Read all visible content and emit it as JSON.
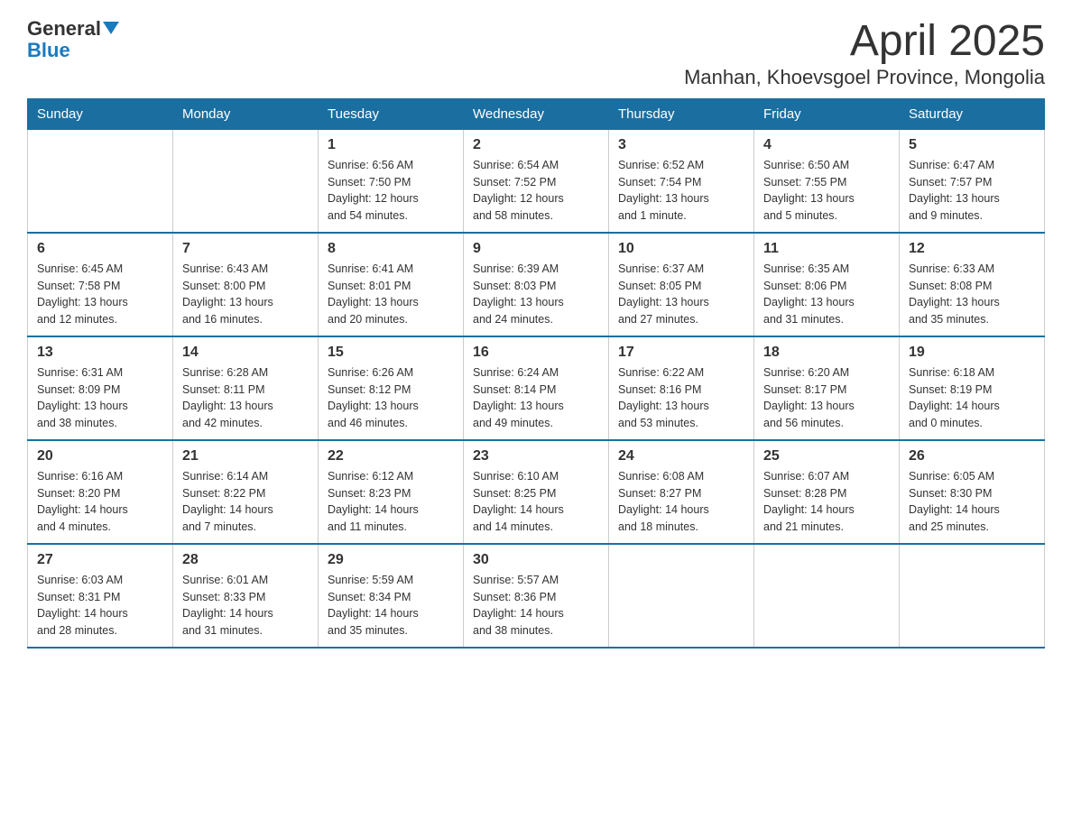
{
  "logo": {
    "text_general": "General",
    "text_blue": "Blue"
  },
  "title": "April 2025",
  "subtitle": "Manhan, Khoevsgoel Province, Mongolia",
  "weekdays": [
    "Sunday",
    "Monday",
    "Tuesday",
    "Wednesday",
    "Thursday",
    "Friday",
    "Saturday"
  ],
  "weeks": [
    [
      {
        "day": "",
        "info": ""
      },
      {
        "day": "",
        "info": ""
      },
      {
        "day": "1",
        "info": "Sunrise: 6:56 AM\nSunset: 7:50 PM\nDaylight: 12 hours\nand 54 minutes."
      },
      {
        "day": "2",
        "info": "Sunrise: 6:54 AM\nSunset: 7:52 PM\nDaylight: 12 hours\nand 58 minutes."
      },
      {
        "day": "3",
        "info": "Sunrise: 6:52 AM\nSunset: 7:54 PM\nDaylight: 13 hours\nand 1 minute."
      },
      {
        "day": "4",
        "info": "Sunrise: 6:50 AM\nSunset: 7:55 PM\nDaylight: 13 hours\nand 5 minutes."
      },
      {
        "day": "5",
        "info": "Sunrise: 6:47 AM\nSunset: 7:57 PM\nDaylight: 13 hours\nand 9 minutes."
      }
    ],
    [
      {
        "day": "6",
        "info": "Sunrise: 6:45 AM\nSunset: 7:58 PM\nDaylight: 13 hours\nand 12 minutes."
      },
      {
        "day": "7",
        "info": "Sunrise: 6:43 AM\nSunset: 8:00 PM\nDaylight: 13 hours\nand 16 minutes."
      },
      {
        "day": "8",
        "info": "Sunrise: 6:41 AM\nSunset: 8:01 PM\nDaylight: 13 hours\nand 20 minutes."
      },
      {
        "day": "9",
        "info": "Sunrise: 6:39 AM\nSunset: 8:03 PM\nDaylight: 13 hours\nand 24 minutes."
      },
      {
        "day": "10",
        "info": "Sunrise: 6:37 AM\nSunset: 8:05 PM\nDaylight: 13 hours\nand 27 minutes."
      },
      {
        "day": "11",
        "info": "Sunrise: 6:35 AM\nSunset: 8:06 PM\nDaylight: 13 hours\nand 31 minutes."
      },
      {
        "day": "12",
        "info": "Sunrise: 6:33 AM\nSunset: 8:08 PM\nDaylight: 13 hours\nand 35 minutes."
      }
    ],
    [
      {
        "day": "13",
        "info": "Sunrise: 6:31 AM\nSunset: 8:09 PM\nDaylight: 13 hours\nand 38 minutes."
      },
      {
        "day": "14",
        "info": "Sunrise: 6:28 AM\nSunset: 8:11 PM\nDaylight: 13 hours\nand 42 minutes."
      },
      {
        "day": "15",
        "info": "Sunrise: 6:26 AM\nSunset: 8:12 PM\nDaylight: 13 hours\nand 46 minutes."
      },
      {
        "day": "16",
        "info": "Sunrise: 6:24 AM\nSunset: 8:14 PM\nDaylight: 13 hours\nand 49 minutes."
      },
      {
        "day": "17",
        "info": "Sunrise: 6:22 AM\nSunset: 8:16 PM\nDaylight: 13 hours\nand 53 minutes."
      },
      {
        "day": "18",
        "info": "Sunrise: 6:20 AM\nSunset: 8:17 PM\nDaylight: 13 hours\nand 56 minutes."
      },
      {
        "day": "19",
        "info": "Sunrise: 6:18 AM\nSunset: 8:19 PM\nDaylight: 14 hours\nand 0 minutes."
      }
    ],
    [
      {
        "day": "20",
        "info": "Sunrise: 6:16 AM\nSunset: 8:20 PM\nDaylight: 14 hours\nand 4 minutes."
      },
      {
        "day": "21",
        "info": "Sunrise: 6:14 AM\nSunset: 8:22 PM\nDaylight: 14 hours\nand 7 minutes."
      },
      {
        "day": "22",
        "info": "Sunrise: 6:12 AM\nSunset: 8:23 PM\nDaylight: 14 hours\nand 11 minutes."
      },
      {
        "day": "23",
        "info": "Sunrise: 6:10 AM\nSunset: 8:25 PM\nDaylight: 14 hours\nand 14 minutes."
      },
      {
        "day": "24",
        "info": "Sunrise: 6:08 AM\nSunset: 8:27 PM\nDaylight: 14 hours\nand 18 minutes."
      },
      {
        "day": "25",
        "info": "Sunrise: 6:07 AM\nSunset: 8:28 PM\nDaylight: 14 hours\nand 21 minutes."
      },
      {
        "day": "26",
        "info": "Sunrise: 6:05 AM\nSunset: 8:30 PM\nDaylight: 14 hours\nand 25 minutes."
      }
    ],
    [
      {
        "day": "27",
        "info": "Sunrise: 6:03 AM\nSunset: 8:31 PM\nDaylight: 14 hours\nand 28 minutes."
      },
      {
        "day": "28",
        "info": "Sunrise: 6:01 AM\nSunset: 8:33 PM\nDaylight: 14 hours\nand 31 minutes."
      },
      {
        "day": "29",
        "info": "Sunrise: 5:59 AM\nSunset: 8:34 PM\nDaylight: 14 hours\nand 35 minutes."
      },
      {
        "day": "30",
        "info": "Sunrise: 5:57 AM\nSunset: 8:36 PM\nDaylight: 14 hours\nand 38 minutes."
      },
      {
        "day": "",
        "info": ""
      },
      {
        "day": "",
        "info": ""
      },
      {
        "day": "",
        "info": ""
      }
    ]
  ]
}
